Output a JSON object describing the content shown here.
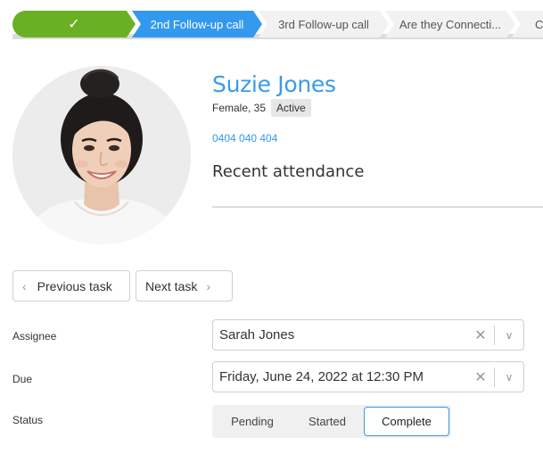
{
  "progress": {
    "steps": [
      {
        "label": "✓",
        "state": "done"
      },
      {
        "label": "2nd Follow-up call",
        "state": "current"
      },
      {
        "label": "3rd Follow-up call",
        "state": "upcoming"
      },
      {
        "label": "Are they Connecti...",
        "state": "upcoming"
      },
      {
        "label": "Cl",
        "state": "upcoming"
      }
    ]
  },
  "profile": {
    "name": "Suzie Jones",
    "gender_age": "Female, 35",
    "status_badge": "Active",
    "phone": "0404 040 404",
    "section_title": "Recent attendance"
  },
  "task_nav": {
    "previous_label": "Previous task",
    "next_label": "Next task"
  },
  "form": {
    "assignee_label": "Assignee",
    "assignee_value": "Sarah Jones",
    "due_label": "Due",
    "due_value": "Friday, June 24, 2022 at 12:30 PM",
    "status_label": "Status",
    "status_options": [
      "Pending",
      "Started",
      "Complete"
    ],
    "status_selected": "Complete"
  },
  "colors": {
    "step_done": "#6ab023",
    "step_current": "#3399ee",
    "accent_link": "#3399ee",
    "name_blue": "#3a9be8"
  }
}
